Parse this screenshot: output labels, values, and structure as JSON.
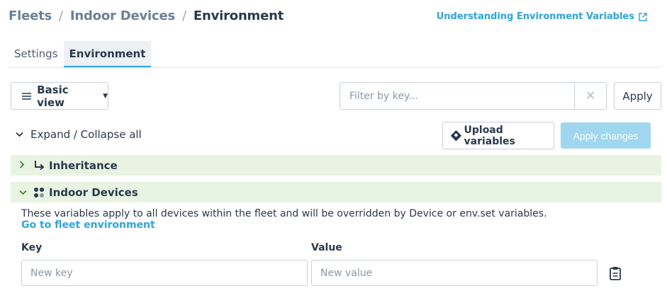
{
  "breadcrumb": {
    "items": [
      "Fleets",
      "Indoor Devices"
    ],
    "current": "Environment",
    "separator": "/"
  },
  "help_link": {
    "label": "Understanding Environment Variables",
    "icon": "external-link-icon"
  },
  "tabs": [
    {
      "label": "Settings",
      "active": false
    },
    {
      "label": "Environment",
      "active": true
    }
  ],
  "toolbar": {
    "view_label": "Basic view",
    "filter_placeholder": "Filter by key...",
    "clear_symbol": "✕",
    "apply_label": "Apply",
    "expand_label": "Expand / Collapse all",
    "upload_label": "Upload variables",
    "apply_changes_label": "Apply changes"
  },
  "sections": {
    "inheritance": {
      "label": "Inheritance",
      "expanded": false,
      "icon": "arrow-down-right-icon"
    },
    "fleet": {
      "label": "Indoor Devices",
      "expanded": true,
      "icon": "fleet-dots-icon",
      "description": "These variables apply to all devices within the fleet and will be overridden by Device or env.set variables.",
      "link_label": "Go to fleet environment",
      "key_label": "Key",
      "value_label": "Value",
      "key_placeholder": "New key",
      "value_placeholder": "New value"
    }
  },
  "colors": {
    "accent": "#2aa7df",
    "section_bg": "#e8f3e1",
    "chevron_green": "#3c8a28",
    "disabled_button": "#9fd7f0",
    "text": "#2a3a4c"
  }
}
